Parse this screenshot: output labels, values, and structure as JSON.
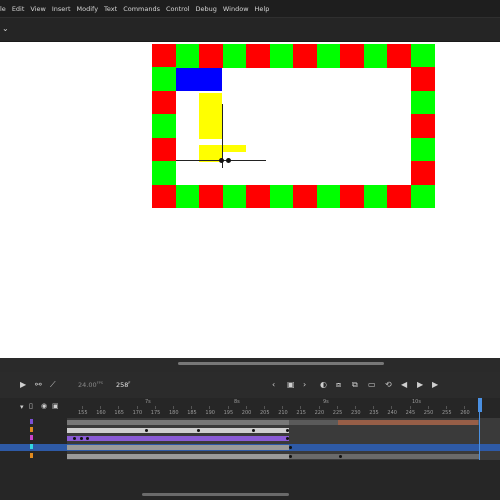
{
  "menu": {
    "items": [
      "le",
      "Edit",
      "View",
      "Insert",
      "Modify",
      "Text",
      "Commands",
      "Control",
      "Debug",
      "Window",
      "Help"
    ]
  },
  "toolbar": {
    "chevron_icon": "chevron-down-icon"
  },
  "stage": {
    "colors": {
      "red": "#ff0000",
      "green": "#00ff00",
      "blue": "#0000ff",
      "yellow": "#ffff00"
    }
  },
  "timeline": {
    "fps": "24.00",
    "fps_unit": "FPS",
    "current_frame": "258",
    "frame_suffix": "F",
    "seconds": [
      "7s",
      "8s",
      "9s",
      "10s"
    ],
    "frames": [
      "155",
      "160",
      "165",
      "170",
      "175",
      "180",
      "185",
      "190",
      "195",
      "200",
      "205",
      "210",
      "215",
      "220",
      "225",
      "230",
      "235",
      "240",
      "245",
      "250",
      "255",
      "260"
    ],
    "icons": {
      "camera": "camera-icon",
      "layer_parent": "layer-parent-icon",
      "graph": "graph-icon",
      "prev": "chevron-left-icon",
      "add_keyframe": "add-keyframe-icon",
      "next": "chevron-right-icon",
      "onion": "onion-skin-icon",
      "edit_multiple": "edit-multiple-icon",
      "loop": "loop-icon",
      "step_back": "step-back-icon",
      "play": "play-icon",
      "step_forward": "step-forward-icon",
      "show_all": "show-all-layers-icon",
      "lock": "lock-icon"
    }
  }
}
